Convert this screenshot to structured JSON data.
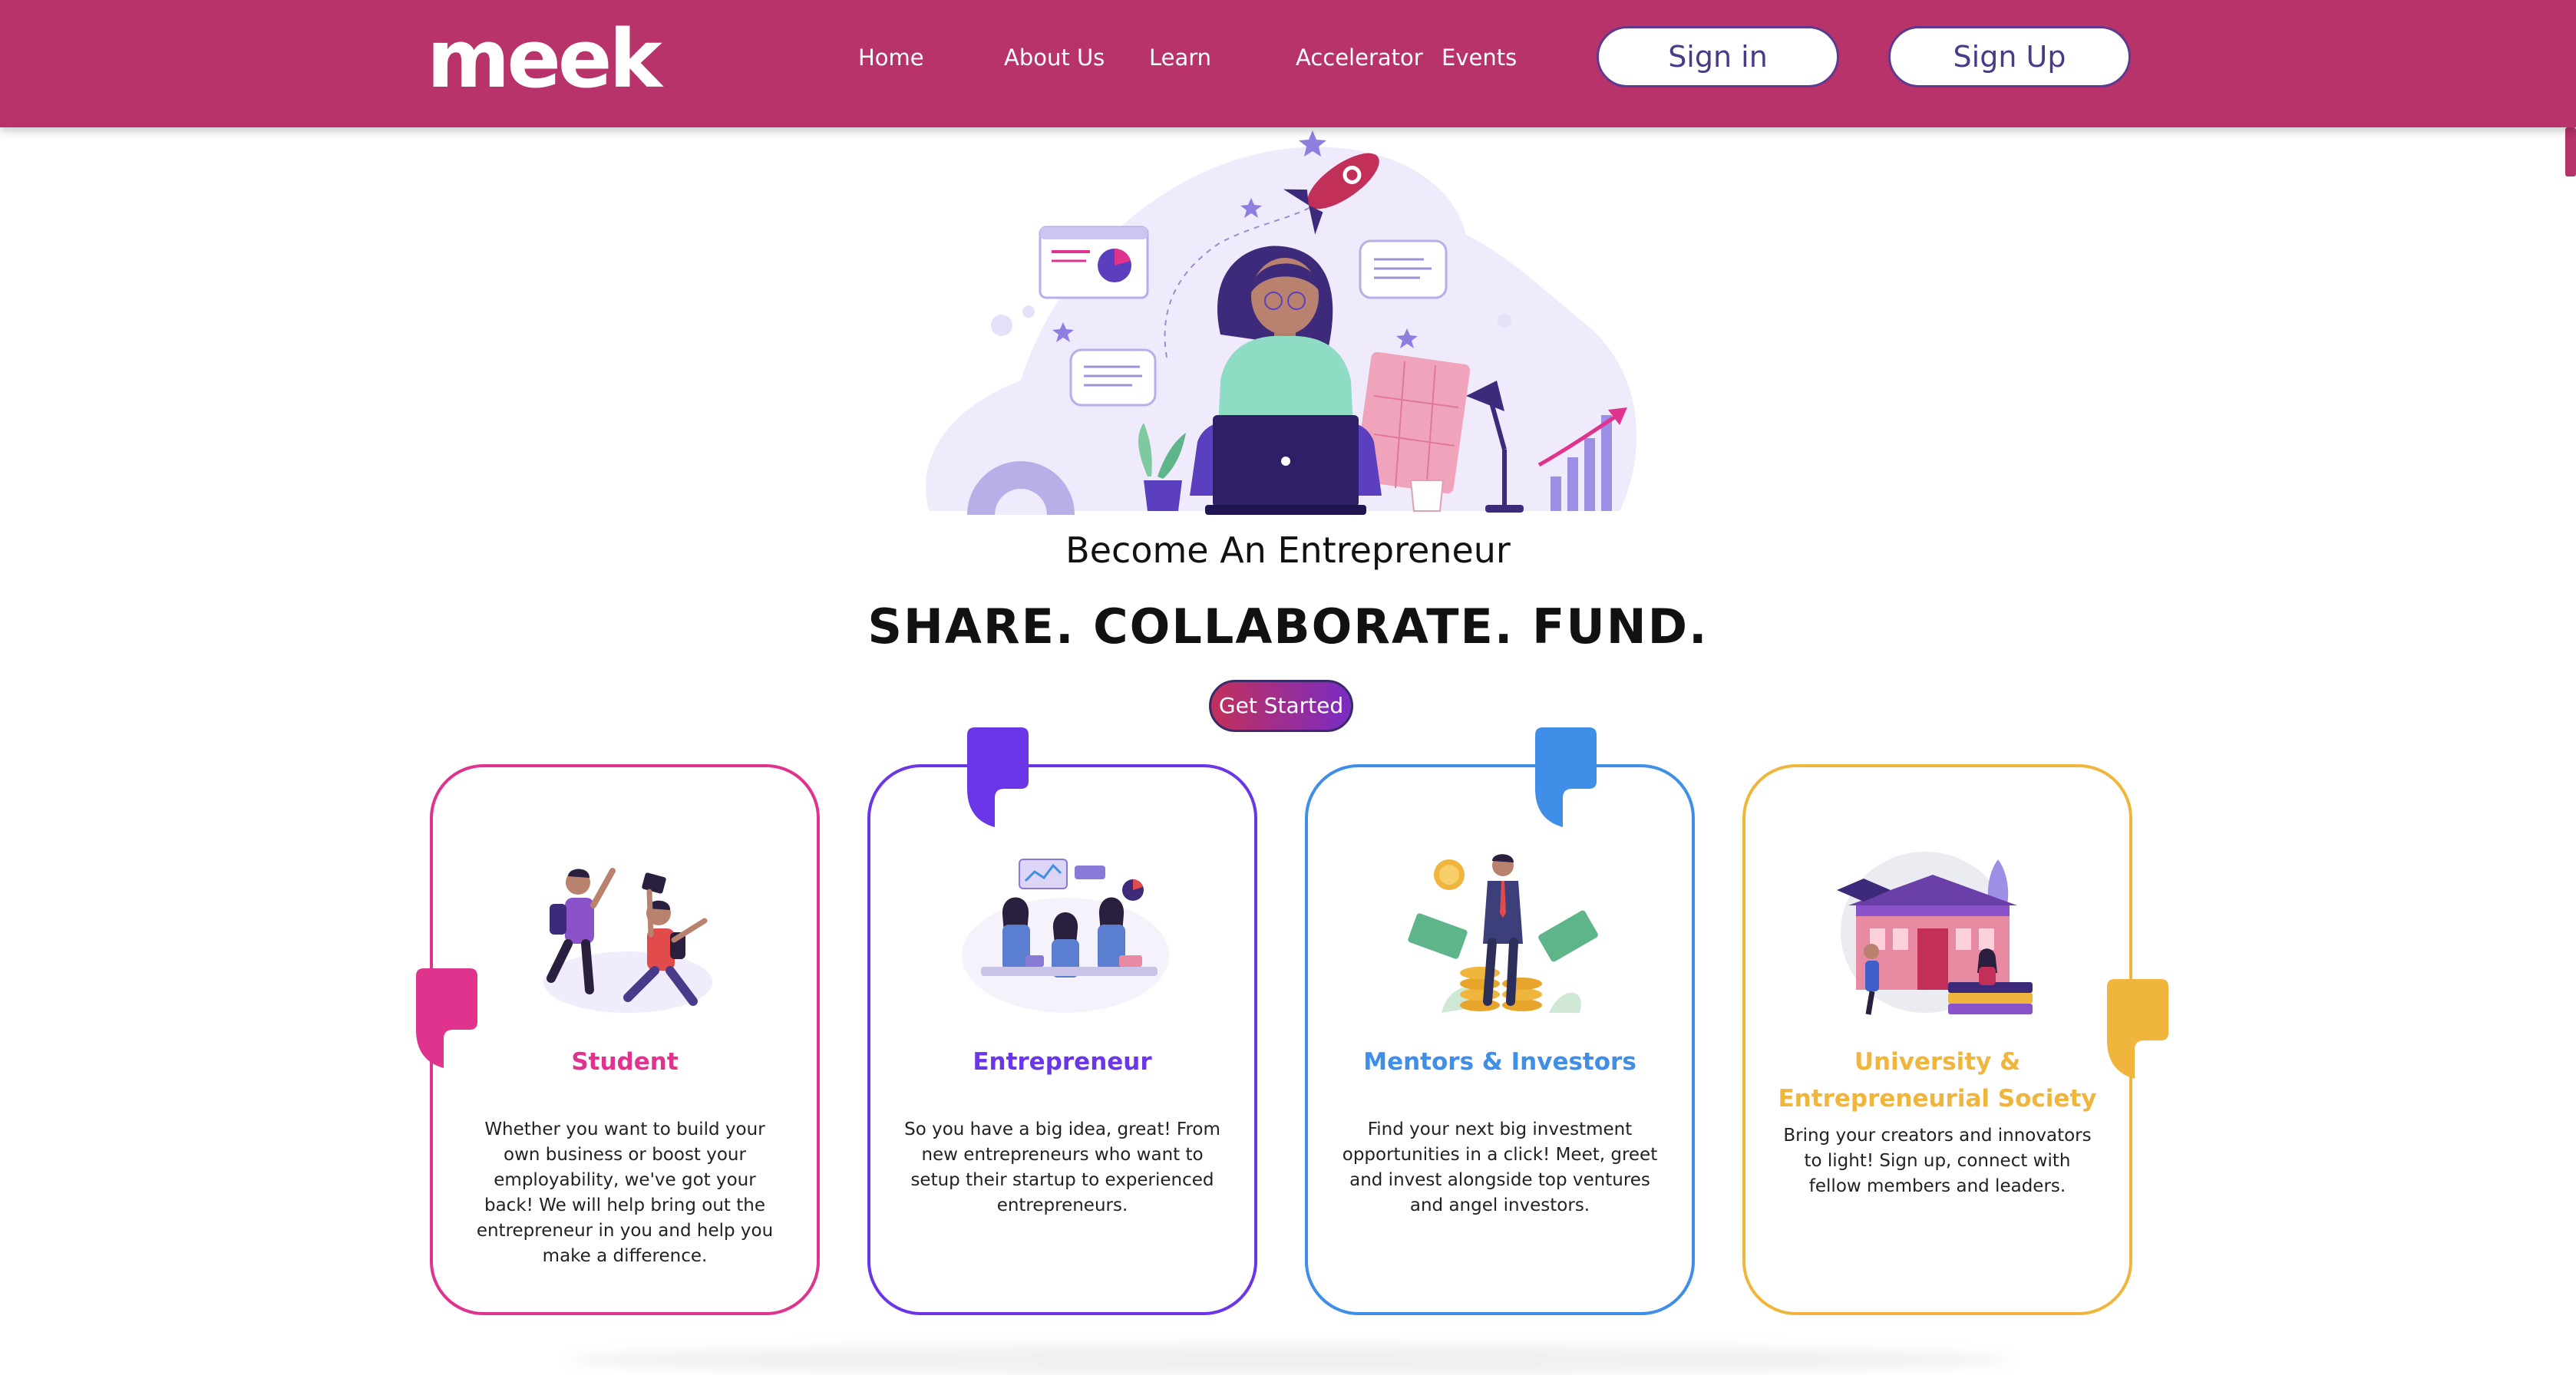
{
  "header": {
    "logo_text": "meek",
    "nav": [
      "Home",
      "About Us",
      "Learn",
      "Accelerator",
      "Events"
    ],
    "sign_in_label": "Sign in",
    "sign_up_label": "Sign Up",
    "bar_color": "#b8336a"
  },
  "hero": {
    "subtitle": "Become An Entrepreneur",
    "title": "SHARE. COLLABORATE. FUND.",
    "cta_label": "Get Started"
  },
  "cards": [
    {
      "title": "Student",
      "description": "Whether you want to build your own business or boost your employability, we've got your back! We will help bring out the entrepreneur in you and help you make a difference.",
      "color": "#e0338e"
    },
    {
      "title": "Entrepreneur",
      "description": "So you have a big idea, great! From new entrepreneurs who want to setup their startup to experienced entrepreneurs.",
      "color": "#6b35e8"
    },
    {
      "title": "Mentors & Investors",
      "description": "Find your next big investment opportunities in a click! Meet, greet and invest alongside top ventures and angel investors.",
      "color": "#3f8ee8"
    },
    {
      "title": "University & Entrepreneurial Society",
      "description": "Bring your creators and innovators to light! Sign up, connect with fellow members and leaders.",
      "color": "#f0b53c"
    }
  ],
  "icons": {
    "hero": "entrepreneur-laptop-illustration",
    "card_illustrations": [
      "jumping-students-illustration",
      "team-meeting-illustration",
      "investor-coins-illustration",
      "university-building-illustration"
    ],
    "quote": "quote-mark-icon"
  }
}
